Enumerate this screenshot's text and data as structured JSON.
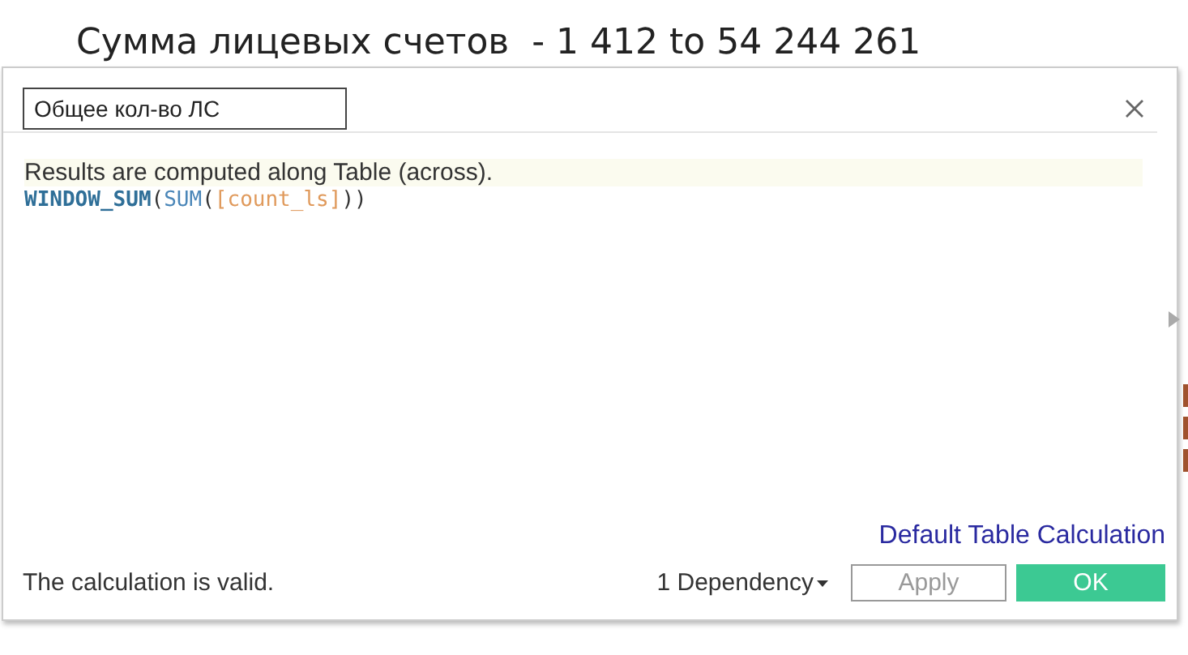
{
  "header": {
    "title": "Сумма лицевых счетов  - 1 412 to 54 244 261"
  },
  "dialog": {
    "name_field": {
      "value": "Общее кол-во ЛС"
    },
    "info": "Results are computed along Table (across).",
    "formula": [
      {
        "kind": "function",
        "text": "WINDOW_SUM"
      },
      {
        "kind": "paren",
        "text": "("
      },
      {
        "kind": "aggregate",
        "text": "SUM"
      },
      {
        "kind": "paren",
        "text": "("
      },
      {
        "kind": "field",
        "text": "[count_ls]"
      },
      {
        "kind": "paren",
        "text": "))"
      }
    ],
    "table_calc_link": "Default Table Calculation",
    "status": "The calculation is valid.",
    "dependency": "1 Dependency",
    "buttons": [
      {
        "label": "Apply",
        "kind": "secondary",
        "disabled": true
      },
      {
        "label": "OK",
        "kind": "primary",
        "disabled": false
      }
    ]
  }
}
